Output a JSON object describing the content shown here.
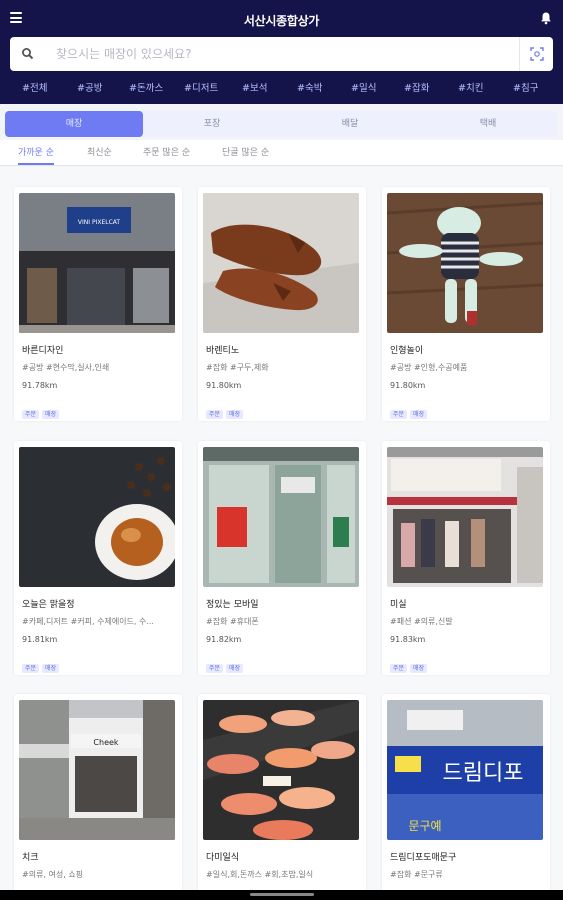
{
  "app": {
    "title": "서산시종합상가"
  },
  "search": {
    "placeholder": "찾으시는 매장이 있으세요?"
  },
  "categories": [
    "#전체",
    "#공방",
    "#돈까스",
    "#디저트",
    "#보석",
    "#숙박",
    "#일식",
    "#잡화",
    "#치킨",
    "#침구"
  ],
  "tabs": [
    {
      "label": "매장",
      "active": true
    },
    {
      "label": "포장",
      "active": false
    },
    {
      "label": "배달",
      "active": false
    },
    {
      "label": "택배",
      "active": false
    }
  ],
  "sorts": [
    {
      "label": "가까운 순",
      "active": true
    },
    {
      "label": "최신순",
      "active": false
    },
    {
      "label": "주문 많은 순",
      "active": false
    },
    {
      "label": "단골 많은 순",
      "active": false
    }
  ],
  "stores": [
    {
      "name": "바른디자인",
      "tags": "#공방 #현수막,실사,인쇄",
      "distance": "91.78km",
      "badges": [
        "주문",
        "매장"
      ]
    },
    {
      "name": "바렌티노",
      "tags": "#잡화 #구두,제화",
      "distance": "91.80km",
      "badges": [
        "주문",
        "매장"
      ]
    },
    {
      "name": "인형놀이",
      "tags": "#공방 #인형,수공예품",
      "distance": "91.80km",
      "badges": [
        "주문",
        "매장"
      ]
    },
    {
      "name": "오늘은 맑을정",
      "tags": "#카페,디저트 #커피, 수제에이드, 수...",
      "distance": "91.81km",
      "badges": [
        "주문",
        "매장"
      ]
    },
    {
      "name": "정있는 모바일",
      "tags": "#잡화 #휴대폰",
      "distance": "91.82km",
      "badges": [
        "주문",
        "매장"
      ]
    },
    {
      "name": "미실",
      "tags": "#패션 #의류,신발",
      "distance": "91.83km",
      "badges": [
        "주문",
        "매장"
      ]
    },
    {
      "name": "치크",
      "tags": "#의류, 여성, 쇼핑",
      "distance": "",
      "badges": []
    },
    {
      "name": "다미일식",
      "tags": "#일식,회,돈까스 #회,초밥,일식",
      "distance": "",
      "badges": []
    },
    {
      "name": "드림디포도매문구",
      "tags": "#잡화 #문구류",
      "distance": "",
      "badges": []
    }
  ],
  "signs": {
    "shop1": "VINI PIXELCAT",
    "shop7": "Cheek",
    "shop9_main": "드림디포",
    "shop9_sub": "문구예"
  },
  "colors": {
    "header": "#14144a",
    "accent": "#6f7bf2",
    "category": "#b7c0ff"
  }
}
